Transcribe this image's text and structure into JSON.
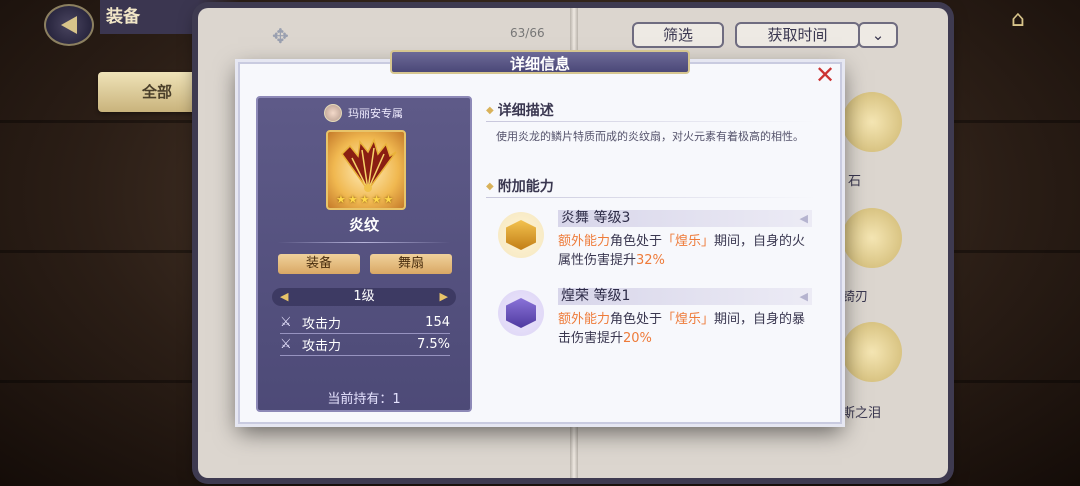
{
  "header": {
    "title": "装备"
  },
  "toolbar": {
    "counter": "63/66",
    "filter_label": "筛选",
    "sort_label": "获取时间"
  },
  "side_tabs": [
    {
      "label": "全部"
    }
  ],
  "background_items": [
    {
      "label": "石"
    },
    {
      "label": "锜刃"
    },
    {
      "label": "斯之泪"
    }
  ],
  "dialog": {
    "title": "详细信息",
    "card": {
      "owner": "玛丽安专属",
      "item_name": "炎纹",
      "stars": 5,
      "tags": [
        "装备",
        "舞扇"
      ],
      "level": "1级",
      "stats": [
        {
          "name": "攻击力",
          "value": "154"
        },
        {
          "name": "攻击力",
          "value": "7.5%"
        }
      ],
      "held": "当前持有：1"
    },
    "description": {
      "title": "详细描述",
      "text": "使用炎龙的鳞片特质而成的炎纹扇，对火元素有着极高的相性。"
    },
    "abilities": {
      "title": "附加能力",
      "items": [
        {
          "name": "炎舞  等级3",
          "prefix": "额外能力",
          "mid1": "角色处于",
          "hl": "「煌乐」",
          "mid2": "期间，自身的火属性伤害提升",
          "value": "32%"
        },
        {
          "name": "煌荣  等级1",
          "prefix": "额外能力",
          "mid1": "角色处于",
          "hl": "「煌乐」",
          "mid2": "期间，自身的暴击伤害提升",
          "value": "20%"
        }
      ]
    }
  },
  "colors": {
    "accent_orange": "#ee7b3a",
    "card_bg": "#5e5a88",
    "header_bg": "#4b4878"
  }
}
